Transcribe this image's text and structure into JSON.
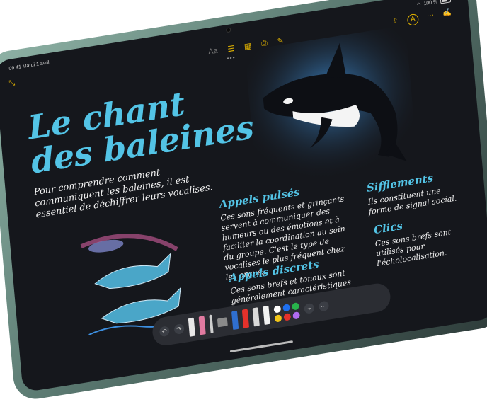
{
  "status": {
    "time": "09:41",
    "date": "Mardi 1 avril",
    "battery": "100 %"
  },
  "toolbar": {
    "text_format": "Aa"
  },
  "note": {
    "title_line1": "Le chant",
    "title_line2": "des baleines",
    "intro": "Pour comprendre comment communiquent les baleines, il est essentiel de déchiffrer leurs vocalises.",
    "sections": [
      {
        "heading": "Appels pulsés",
        "text": "Ces sons fréquents et grinçants servent à communiquer des humeurs ou des émotions et à faciliter la coordination au sein du groupe. C'est le type de vocalises le plus fréquent chez les orques."
      },
      {
        "heading": "Sifflements",
        "text": "Ils constituent une forme de signal social."
      },
      {
        "heading": "Appels discrets",
        "text": "Ces sons brefs et tonaux sont généralement caractéristiques d'un dialecte propre à une espèce"
      },
      {
        "heading": "Clics",
        "text": "Ces sons brefs sont utilisés pour l'écholocalisation."
      }
    ]
  },
  "palette": {
    "colors": [
      "#ffffff",
      "#1e6ff0",
      "#28b34b",
      "#f0c419",
      "#e4312b",
      "#b06bf0"
    ]
  }
}
